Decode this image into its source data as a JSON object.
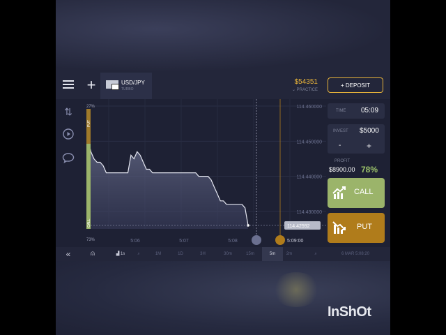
{
  "header": {
    "asset_name": "USD/JPY",
    "asset_type": "TURBO",
    "balance": "$54351",
    "account_mode": "PRACTICE",
    "deposit_label": "+ DEPOSIT"
  },
  "chart": {
    "price_labels": [
      "114.460000",
      "114.450000",
      "114.440000",
      "114.430000"
    ],
    "time_labels": [
      "5:06",
      "5:07",
      "5:08"
    ],
    "expiry_time": "5:09:00",
    "current_price": "114.42592",
    "sentiment_top": "27%",
    "sentiment_bottom": "73%",
    "sentiment_put_label": "PUT",
    "sentiment_call_label": "CALL"
  },
  "chart_data": {
    "type": "area",
    "title": "",
    "xlabel": "",
    "ylabel": "",
    "x_ticks": [
      "5:06",
      "5:07",
      "5:08"
    ],
    "y_ticks": [
      114.46,
      114.45,
      114.44,
      114.43
    ],
    "ylim": [
      114.425,
      114.462
    ],
    "series": [
      {
        "values": [
          114.451,
          114.447,
          114.445,
          114.444,
          114.444,
          114.443,
          114.441,
          114.441,
          114.441,
          114.441,
          114.441,
          114.441,
          114.441,
          114.441,
          114.446,
          114.445,
          114.447,
          114.446,
          114.444,
          114.442,
          114.442,
          114.441,
          114.441,
          114.441,
          114.441,
          114.441,
          114.441,
          114.441,
          114.441,
          114.441,
          114.441,
          114.441,
          114.441,
          114.441,
          114.441,
          114.441,
          114.44,
          114.44,
          114.44,
          114.44,
          114.439,
          114.437,
          114.435,
          114.433,
          114.433,
          114.432,
          114.432,
          114.432,
          114.432,
          114.432,
          114.432,
          114.431,
          114.426
        ]
      }
    ],
    "grid": true
  },
  "panel": {
    "time_label": "TIME",
    "time_value": "05:09",
    "invest_label": "INVEST",
    "invest_value": "$5000",
    "minus": "-",
    "plus": "+",
    "profit_label": "PROFIT",
    "profit_value": "$8900.00",
    "profit_percent": "78%",
    "call_label": "CALL",
    "put_label": "PUT"
  },
  "bottom": {
    "collapse": "«",
    "tick_label": "1s",
    "timeframes": [
      "1M",
      "1D",
      "3H",
      "30m",
      "15m",
      "5m",
      "2m"
    ],
    "active_timeframe": "5m",
    "date_time": "6 MAR 5:08:20"
  },
  "watermark": "InShOt",
  "colors": {
    "gold": "#e8b43a",
    "call_green": "#9bb46a",
    "put_orange": "#b07c1b",
    "background": "#1e2134"
  }
}
